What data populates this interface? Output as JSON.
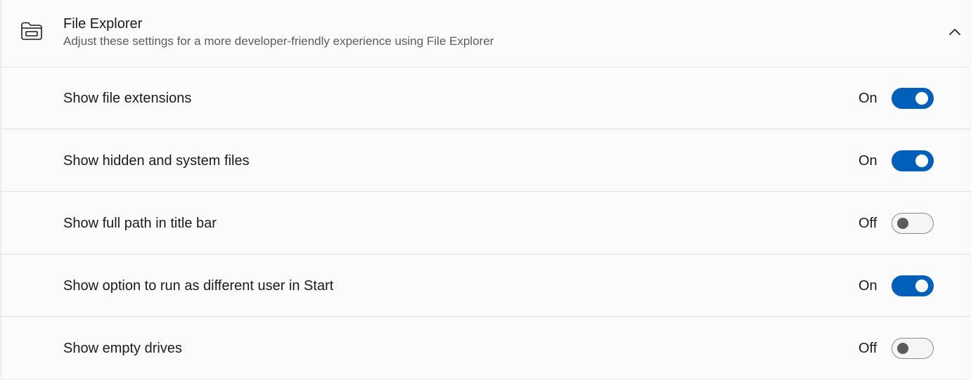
{
  "section": {
    "title": "File Explorer",
    "subtitle": "Adjust these settings for a more developer-friendly experience using File Explorer",
    "icon": "folder-icon",
    "expand_icon": "chevron-up-icon"
  },
  "accent_color": "#005fb8",
  "settings": [
    {
      "label": "Show file extensions",
      "state": "On",
      "enabled": true
    },
    {
      "label": "Show hidden and system files",
      "state": "On",
      "enabled": true
    },
    {
      "label": "Show full path in title bar",
      "state": "Off",
      "enabled": false
    },
    {
      "label": "Show option to run as different user in Start",
      "state": "On",
      "enabled": true
    },
    {
      "label": "Show empty drives",
      "state": "Off",
      "enabled": false
    }
  ]
}
